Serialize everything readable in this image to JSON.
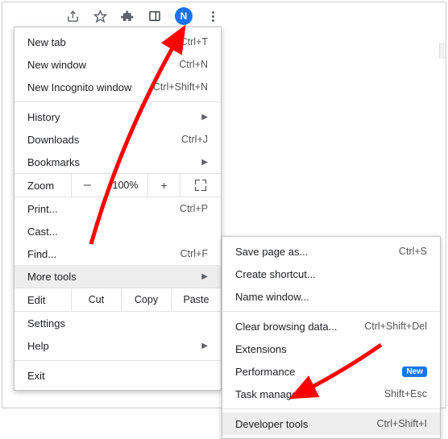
{
  "toolbar": {
    "avatar_letter": "N"
  },
  "menu1": {
    "newTab": {
      "label": "New tab",
      "shortcut": "Ctrl+T"
    },
    "newWindow": {
      "label": "New window",
      "shortcut": "Ctrl+N"
    },
    "newIncognito": {
      "label": "New Incognito window",
      "shortcut": "Ctrl+Shift+N"
    },
    "history": {
      "label": "History"
    },
    "downloads": {
      "label": "Downloads",
      "shortcut": "Ctrl+J"
    },
    "bookmarks": {
      "label": "Bookmarks"
    },
    "zoom": {
      "label": "Zoom",
      "minus": "–",
      "percent": "100%",
      "plus": "+"
    },
    "print": {
      "label": "Print...",
      "shortcut": "Ctrl+P"
    },
    "cast": {
      "label": "Cast..."
    },
    "find": {
      "label": "Find...",
      "shortcut": "Ctrl+F"
    },
    "moreTools": {
      "label": "More tools"
    },
    "edit": {
      "label": "Edit",
      "cut": "Cut",
      "copy": "Copy",
      "paste": "Paste"
    },
    "settings": {
      "label": "Settings"
    },
    "help": {
      "label": "Help"
    },
    "exit": {
      "label": "Exit"
    }
  },
  "menu2": {
    "savePage": {
      "label": "Save page as...",
      "shortcut": "Ctrl+S"
    },
    "createShortcut": {
      "label": "Create shortcut..."
    },
    "nameWindow": {
      "label": "Name window..."
    },
    "clearBrowsing": {
      "label": "Clear browsing data...",
      "shortcut": "Ctrl+Shift+Del"
    },
    "extensions": {
      "label": "Extensions"
    },
    "performance": {
      "label": "Performance",
      "badge": "New"
    },
    "taskManager": {
      "label": "Task manager",
      "shortcut": "Shift+Esc"
    },
    "devTools": {
      "label": "Developer tools",
      "shortcut": "Ctrl+Shift+I"
    }
  }
}
